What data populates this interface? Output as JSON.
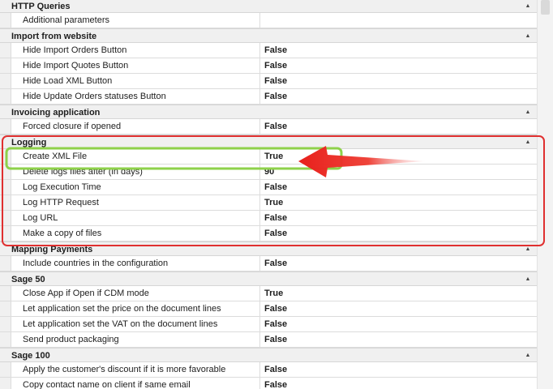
{
  "property_grid": {
    "categories": [
      {
        "label": "HTTP Queries",
        "rows": [
          {
            "name": "Additional parameters",
            "value": ""
          }
        ]
      },
      {
        "label": "Import from website",
        "rows": [
          {
            "name": "Hide Import Orders Button",
            "value": "False"
          },
          {
            "name": "Hide Import Quotes Button",
            "value": "False"
          },
          {
            "name": "Hide Load XML Button",
            "value": "False"
          },
          {
            "name": "Hide Update Orders statuses Button",
            "value": "False"
          }
        ]
      },
      {
        "label": "Invoicing application",
        "rows": [
          {
            "name": "Forced closure if opened",
            "value": "False"
          }
        ]
      },
      {
        "label": "Logging",
        "rows": [
          {
            "name": "Create XML File",
            "value": "True"
          },
          {
            "name": "Delete logs files after (in days)",
            "value": "90"
          },
          {
            "name": "Log Execution Time",
            "value": "False"
          },
          {
            "name": "Log HTTP Request",
            "value": "True"
          },
          {
            "name": "Log URL",
            "value": "False"
          },
          {
            "name": "Make a copy of files",
            "value": "False"
          }
        ]
      },
      {
        "label": "Mapping Payments",
        "rows": [
          {
            "name": "Include countries in the configuration",
            "value": "False"
          }
        ]
      },
      {
        "label": "Sage 50",
        "rows": [
          {
            "name": "Close App if Open if CDM mode",
            "value": "True"
          },
          {
            "name": "Let application set the price on the document lines",
            "value": "False"
          },
          {
            "name": "Let application set the VAT on the document lines",
            "value": "False"
          },
          {
            "name": "Send product packaging",
            "value": "False"
          }
        ]
      },
      {
        "label": "Sage 100",
        "rows": [
          {
            "name": "Apply the customer's discount if it is more favorable",
            "value": "False"
          },
          {
            "name": "Copy contact name on client if same email",
            "value": "False"
          }
        ]
      }
    ]
  },
  "annotations": {
    "outline_color": "#e03030",
    "highlight_color": "#8ed14a",
    "arrow_color": "#e8201c"
  },
  "icons": {
    "collapse": "▲"
  }
}
